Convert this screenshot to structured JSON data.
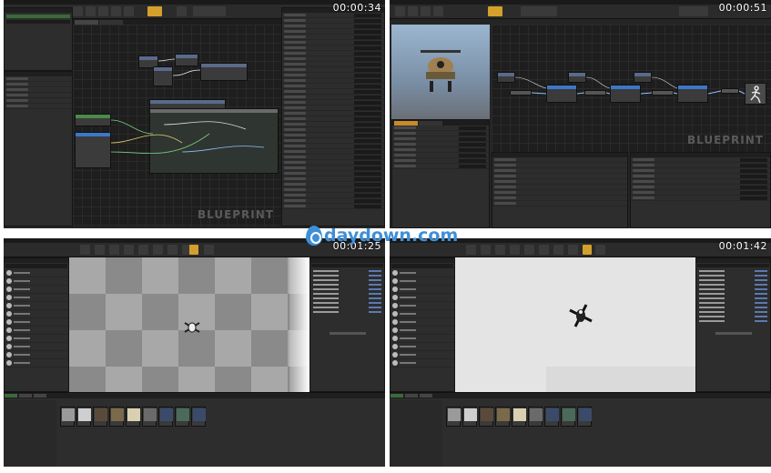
{
  "timestamps": [
    "00:00:34",
    "00:00:51",
    "00:01:25",
    "00:01:42"
  ],
  "watermark": {
    "text": "daydown.com",
    "icon": "water-drop-icon"
  },
  "overlay_label": "BLUEPRINT",
  "colors": {
    "accent": "#d4a02c",
    "watermark": "#3f8fd8",
    "blueprint_wire": "#8fc0ff"
  }
}
